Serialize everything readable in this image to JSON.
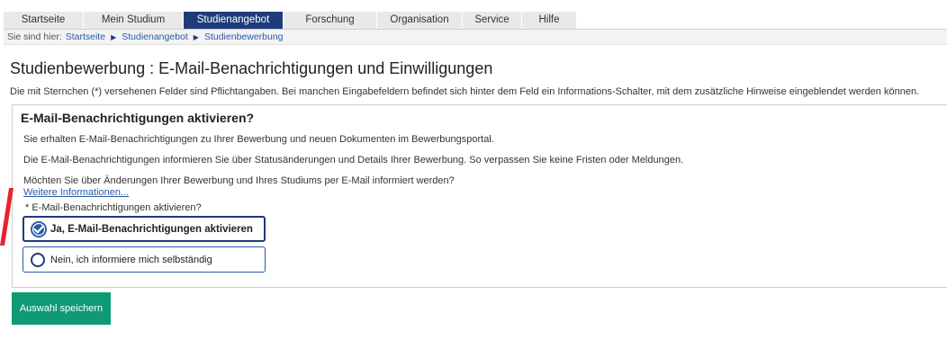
{
  "nav": {
    "tabs": [
      {
        "label": "Startseite"
      },
      {
        "label": "Mein Studium"
      },
      {
        "label": "Studienangebot"
      },
      {
        "label": "Forschung"
      },
      {
        "label": "Organisation"
      },
      {
        "label": "Service"
      },
      {
        "label": "Hilfe"
      }
    ],
    "active_tab": "Studienangebot"
  },
  "breadcrumb": {
    "label": "Sie sind hier:",
    "items": [
      "Startseite",
      "Studienangebot",
      "Studienbewerbung"
    ]
  },
  "page": {
    "title": "Studienbewerbung : E-Mail-Benachrichtigungen und Einwilligungen",
    "hint": "Die mit Sternchen (*) versehenen Felder sind Pflichtangaben. Bei manchen Eingabefeldern befindet sich hinter dem Feld ein Informations-Schalter, mit dem zusätzliche Hinweise eingeblendet werden können."
  },
  "panel": {
    "title": "E-Mail-Benachrichtigungen aktivieren?",
    "text1": "Sie erhalten E-Mail-Benachrichtigungen zu Ihrer Bewerbung und neuen Dokumenten im Bewerbungsportal.",
    "text2": "Die E-Mail-Benachrichtigungen informieren Sie über Statusänderungen und Details Ihrer Bewerbung. So verpassen Sie keine Fristen oder Meldungen.",
    "question": "Möchten Sie über Änderungen Ihrer Bewerbung und Ihres Studiums per E-Mail informiert werden?",
    "more_link": "Weitere Informationen...",
    "field_label": "* E-Mail-Benachrichtigungen aktivieren?",
    "options": [
      {
        "label": "Ja, E-Mail-Benachrichtigungen aktivieren",
        "selected": true
      },
      {
        "label": "Nein, ich informiere mich selbständig",
        "selected": false
      }
    ]
  },
  "save_button": "Auswahl speichern",
  "colors": {
    "nav_active": "#1f3b7a",
    "link": "#2a5aa8",
    "save_button": "#0e9a74",
    "annotation_arrow": "#e8232a"
  },
  "icons": {
    "selected_radio": "check-circle-icon",
    "unselected_radio": "radio-empty-icon",
    "breadcrumb_separator": "triangle-right-icon"
  }
}
